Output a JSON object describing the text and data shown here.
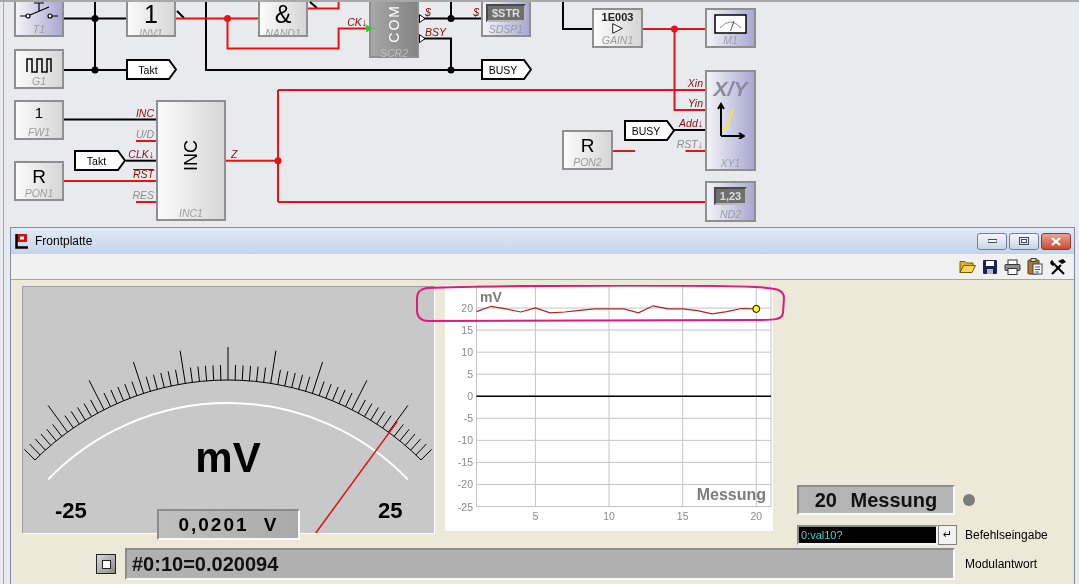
{
  "diagram": {
    "blocks": [
      {
        "kind": "switch",
        "label": "T1",
        "highlighted": true
      },
      {
        "kind": "logic",
        "symbol": "1",
        "label": "INV1",
        "highlighted": false
      },
      {
        "kind": "logic",
        "symbol": "&",
        "label": "NAND1",
        "highlighted": false
      },
      {
        "kind": "com",
        "symbol": "COM",
        "label": "SCR2",
        "highlighted": false,
        "inputs": [
          {
            "label": "CK↓",
            "disabled": false,
            "inverted": false
          }
        ],
        "outputs": [
          {
            "label": "$",
            "disabled": false,
            "inverted": false
          },
          {
            "label": "BSY",
            "disabled": false,
            "inverted": false
          }
        ]
      },
      {
        "kind": "display",
        "symbol": "$STR",
        "label": "SDSP1",
        "highlighted": true,
        "inputs": [
          {
            "label": "$",
            "disabled": false,
            "inverted": false
          }
        ]
      },
      {
        "kind": "gain",
        "symbol": "1E003",
        "label": "GAIN1",
        "highlighted": false
      },
      {
        "kind": "meter",
        "label": "M1",
        "highlighted": true
      },
      {
        "kind": "generator",
        "label": "G1",
        "highlighted": false
      },
      {
        "kind": "constant",
        "symbol": "1",
        "label": "FW1",
        "highlighted": false
      },
      {
        "kind": "counter",
        "symbol": "INC",
        "label": "INC1",
        "highlighted": false,
        "inputs": [
          {
            "label": "INC",
            "disabled": false,
            "inverted": false
          },
          {
            "label": "U/D",
            "disabled": true,
            "inverted": false
          },
          {
            "label": "CLK↓",
            "disabled": false,
            "inverted": false
          },
          {
            "label": "RST",
            "disabled": false,
            "inverted": true
          },
          {
            "label": "RES",
            "disabled": true,
            "inverted": false
          }
        ],
        "outputs": [
          {
            "label": "Z",
            "disabled": false,
            "inverted": false
          }
        ]
      },
      {
        "kind": "reset",
        "symbol": "R",
        "label": "PON2",
        "highlighted": false
      },
      {
        "kind": "xy",
        "symbol": "X/Y",
        "label": "XY1",
        "highlighted": true,
        "inputs": [
          {
            "label": "Xin",
            "disabled": false,
            "inverted": false
          },
          {
            "label": "Yin",
            "disabled": false,
            "inverted": false
          },
          {
            "label": "Add↓",
            "disabled": false,
            "inverted": false
          },
          {
            "label": "RST↓",
            "disabled": true,
            "inverted": false
          }
        ]
      },
      {
        "kind": "reset",
        "symbol": "R",
        "label": "PON1",
        "highlighted": false
      },
      {
        "kind": "display",
        "symbol": "1,23",
        "label": "ND2",
        "highlighted": true
      }
    ],
    "tags": [
      {
        "text": "Takt"
      },
      {
        "text": "BUSY"
      },
      {
        "text": "Takt"
      },
      {
        "text": "BUSY"
      }
    ]
  },
  "window": {
    "title": "Frontplatte"
  },
  "meter": {
    "unit": "mV",
    "min_label": "-25",
    "max_label": "25",
    "level": 0.902,
    "readout": "0,0201 V"
  },
  "chart": {
    "chart_data": {
      "type": "line",
      "xlabel": "Messung",
      "ylabel": "mV",
      "x": [
        1,
        2,
        3,
        4,
        5,
        6,
        7,
        8,
        9,
        10,
        11,
        12,
        13,
        14,
        15,
        16,
        17,
        18,
        19,
        20
      ],
      "values": [
        19.2,
        20.4,
        19.8,
        19.1,
        20.0,
        18.9,
        19.1,
        19.5,
        19.8,
        19.8,
        19.8,
        18.9,
        20.5,
        19.8,
        19.8,
        19.4,
        18.7,
        19.2,
        19.9,
        19.8
      ],
      "xlim": [
        1,
        21
      ],
      "ylim": [
        -25,
        25
      ],
      "xticks": [
        5,
        10,
        15,
        20
      ],
      "yticks": [
        -25,
        -20,
        -15,
        -10,
        -5,
        0,
        5,
        10,
        15,
        20
      ],
      "grid": true
    }
  },
  "status": {
    "display": "20 Messung",
    "light_on": false
  },
  "command": {
    "value": "0:val10?",
    "enter_key": "↵",
    "label": "Befehlseingabe"
  },
  "response": {
    "value": "#0:10=0.020094",
    "label": "Modulantwort"
  }
}
